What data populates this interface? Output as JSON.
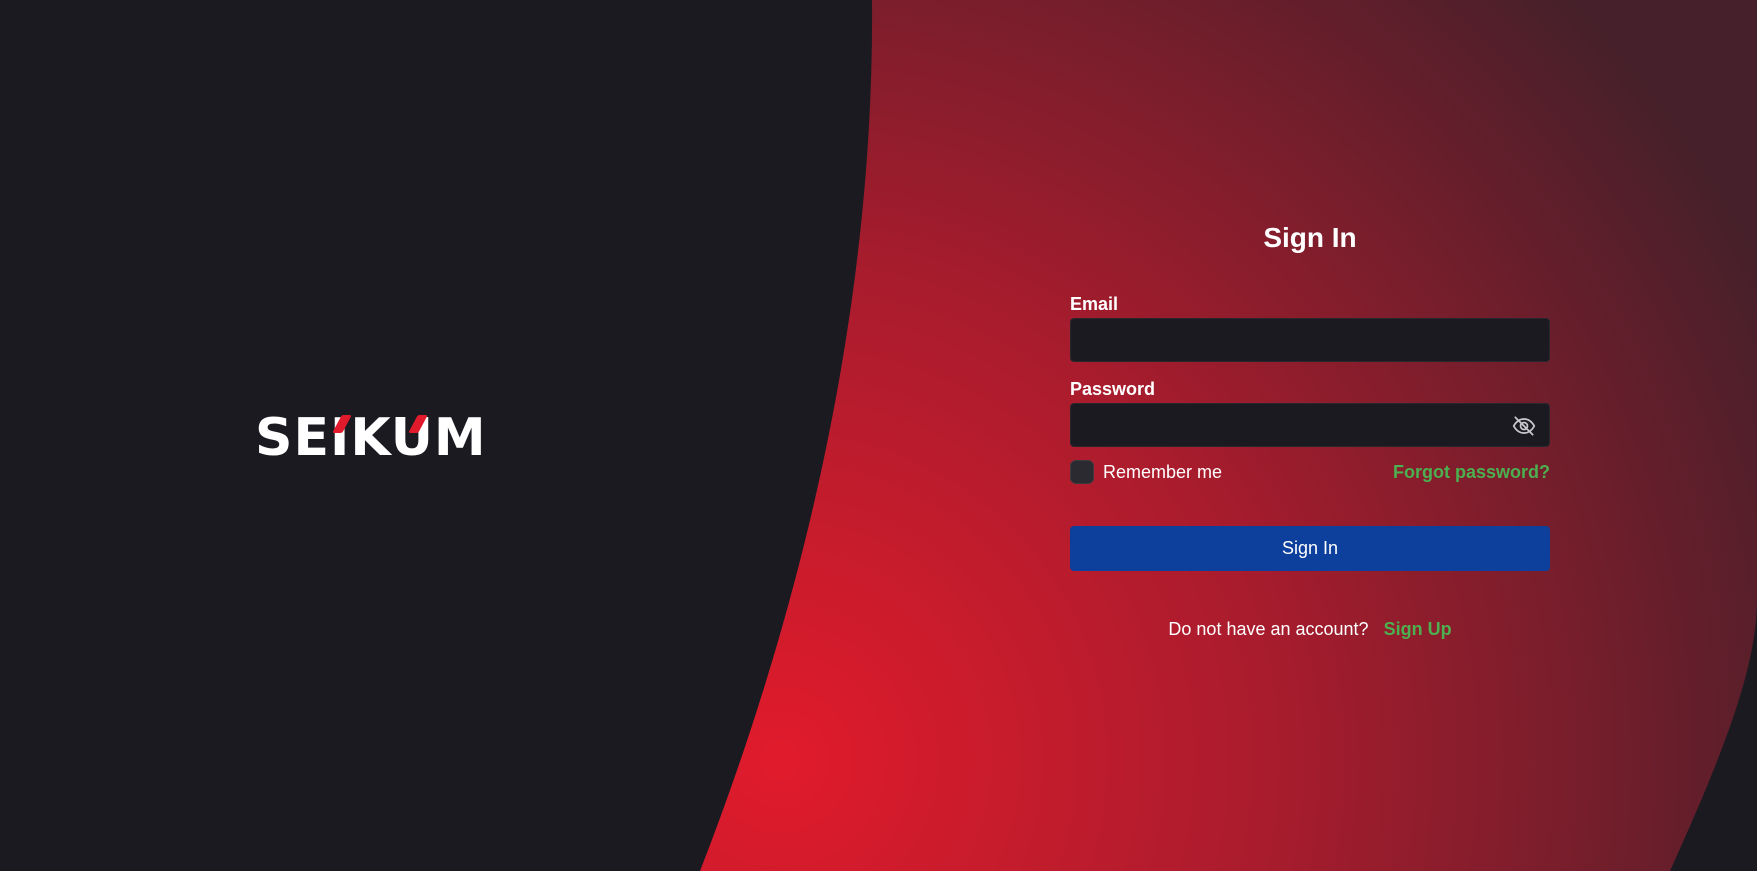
{
  "brand": {
    "logo_text": "SEIKUM",
    "accent_color": "#e11b2c"
  },
  "colors": {
    "background": "#1b1a21",
    "gradient_start": "#e11b2c",
    "gradient_end": "#4a1f2a",
    "primary_button": "#0d3f9c",
    "link": "#4caf50"
  },
  "form": {
    "title": "Sign In",
    "email": {
      "label": "Email",
      "value": "",
      "placeholder": ""
    },
    "password": {
      "label": "Password",
      "value": "",
      "placeholder": "",
      "toggle_icon": "eye-off-icon"
    },
    "remember_label": "Remember me",
    "remember_checked": false,
    "forgot_link": "Forgot password?",
    "submit_label": "Sign In",
    "signup_prompt": "Do not have an account?",
    "signup_link": "Sign Up"
  }
}
